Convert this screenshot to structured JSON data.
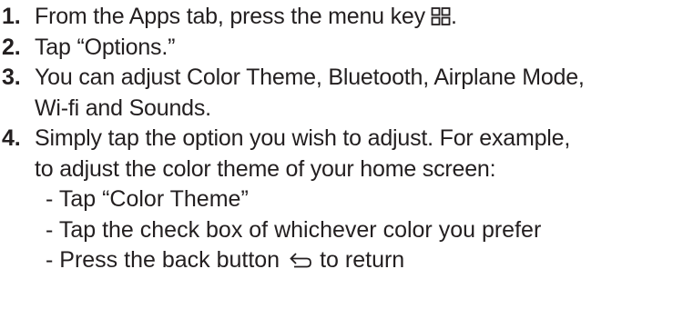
{
  "steps": [
    {
      "number": "1.",
      "text": "From the Apps tab, press the menu key",
      "icon": "menu-key-icon",
      "suffix": "."
    },
    {
      "number": "2.",
      "text": "Tap “Options.”"
    },
    {
      "number": "3.",
      "lines": [
        "You can adjust Color Theme, Bluetooth, Airplane Mode,",
        "Wi-fi and Sounds."
      ]
    },
    {
      "number": "4.",
      "lines": [
        "Simply tap the option you wish to adjust. For example,",
        "to adjust the color theme of your home screen:"
      ]
    }
  ],
  "sub_steps": [
    {
      "text": "- Tap “Color Theme”"
    },
    {
      "text": "- Tap the check box of whichever color you prefer"
    },
    {
      "text": "- Press the back button",
      "icon": "back-arrow-icon",
      "suffix": "to return"
    }
  ],
  "colors": {
    "text": "#231f20",
    "background": "#ffffff"
  }
}
